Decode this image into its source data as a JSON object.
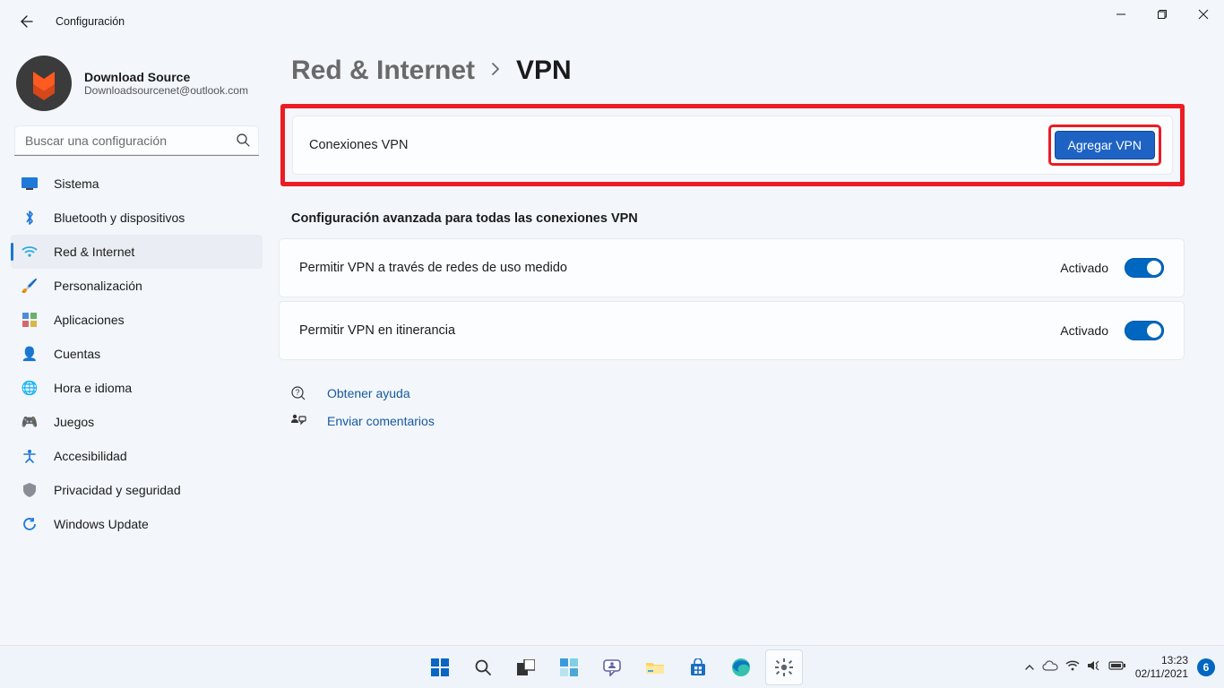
{
  "app": {
    "title": "Configuración"
  },
  "window_controls": {
    "minimize": "minimize",
    "maximize": "maximize",
    "close": "close"
  },
  "profile": {
    "name": "Download Source",
    "email": "Downloadsourcenet@outlook.com"
  },
  "search": {
    "placeholder": "Buscar una configuración"
  },
  "nav": {
    "sistema": "Sistema",
    "bluetooth": "Bluetooth y dispositivos",
    "red": "Red & Internet",
    "personalizacion": "Personalización",
    "aplicaciones": "Aplicaciones",
    "cuentas": "Cuentas",
    "hora": "Hora e idioma",
    "juegos": "Juegos",
    "accesibilidad": "Accesibilidad",
    "privacidad": "Privacidad y seguridad",
    "update": "Windows Update"
  },
  "breadcrumb": {
    "parent": "Red & Internet",
    "current": "VPN"
  },
  "vpn_card": {
    "title": "Conexiones VPN",
    "button": "Agregar VPN"
  },
  "adv_header": "Configuración avanzada para todas las conexiones VPN",
  "settings": [
    {
      "label": "Permitir VPN a través de redes de uso medido",
      "state": "Activado",
      "on": true
    },
    {
      "label": "Permitir VPN en itinerancia",
      "state": "Activado",
      "on": true
    }
  ],
  "footer": {
    "help": "Obtener ayuda",
    "feedback": "Enviar comentarios"
  },
  "taskbar": {
    "time": "13:23",
    "date": "02/11/2021",
    "widget_count": "6"
  },
  "colors": {
    "accent": "#0067c0",
    "highlight": "#ec1c24",
    "link": "#15599e"
  }
}
